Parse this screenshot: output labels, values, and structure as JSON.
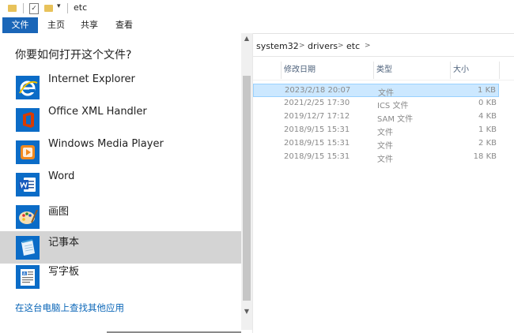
{
  "titlebar": {
    "title": "etc",
    "qa_check": "✓",
    "qa_down": "▾"
  },
  "ribbon": {
    "tabs": [
      "文件",
      "主页",
      "共享",
      "查看"
    ]
  },
  "dialog": {
    "title": "你要如何打开这个文件?",
    "apps": [
      {
        "label": "Internet Explorer",
        "icon": "internet-explorer-icon"
      },
      {
        "label": "Office XML Handler",
        "icon": "office-icon"
      },
      {
        "label": "Windows Media Player",
        "icon": "windows-media-player-icon"
      },
      {
        "label": "Word",
        "icon": "word-icon"
      },
      {
        "label": "画图",
        "icon": "paint-icon"
      },
      {
        "label": "记事本",
        "icon": "notepad-icon"
      },
      {
        "label": "写字板",
        "icon": "wordpad-icon"
      }
    ],
    "selected_index": 5,
    "more_apps_link": "在这台电脑上查找其他应用"
  },
  "scrollbar": {
    "up": "▲",
    "down": "▼"
  },
  "breadcrumb": [
    "system32",
    "drivers",
    "etc"
  ],
  "breadcrumb_sep": ">",
  "columns": {
    "date": "修改日期",
    "type": "类型",
    "size": "大小"
  },
  "files": [
    {
      "date": "2023/2/18 20:07",
      "type": "文件",
      "size": "1 KB",
      "selected": true
    },
    {
      "date": "2021/2/25 17:30",
      "type": "ICS 文件",
      "size": "0 KB"
    },
    {
      "date": "2019/12/7 17:12",
      "type": "SAM 文件",
      "size": "4 KB"
    },
    {
      "date": "2018/9/15 15:31",
      "type": "文件",
      "size": "1 KB"
    },
    {
      "date": "2018/9/15 15:31",
      "type": "文件",
      "size": "2 KB"
    },
    {
      "date": "2018/9/15 15:31",
      "type": "文件",
      "size": "18 KB"
    }
  ],
  "colors": {
    "accent": "#1a66b8",
    "selection": "#cce8ff",
    "link": "#0a66b8",
    "selected_app": "#d4d4d4"
  }
}
